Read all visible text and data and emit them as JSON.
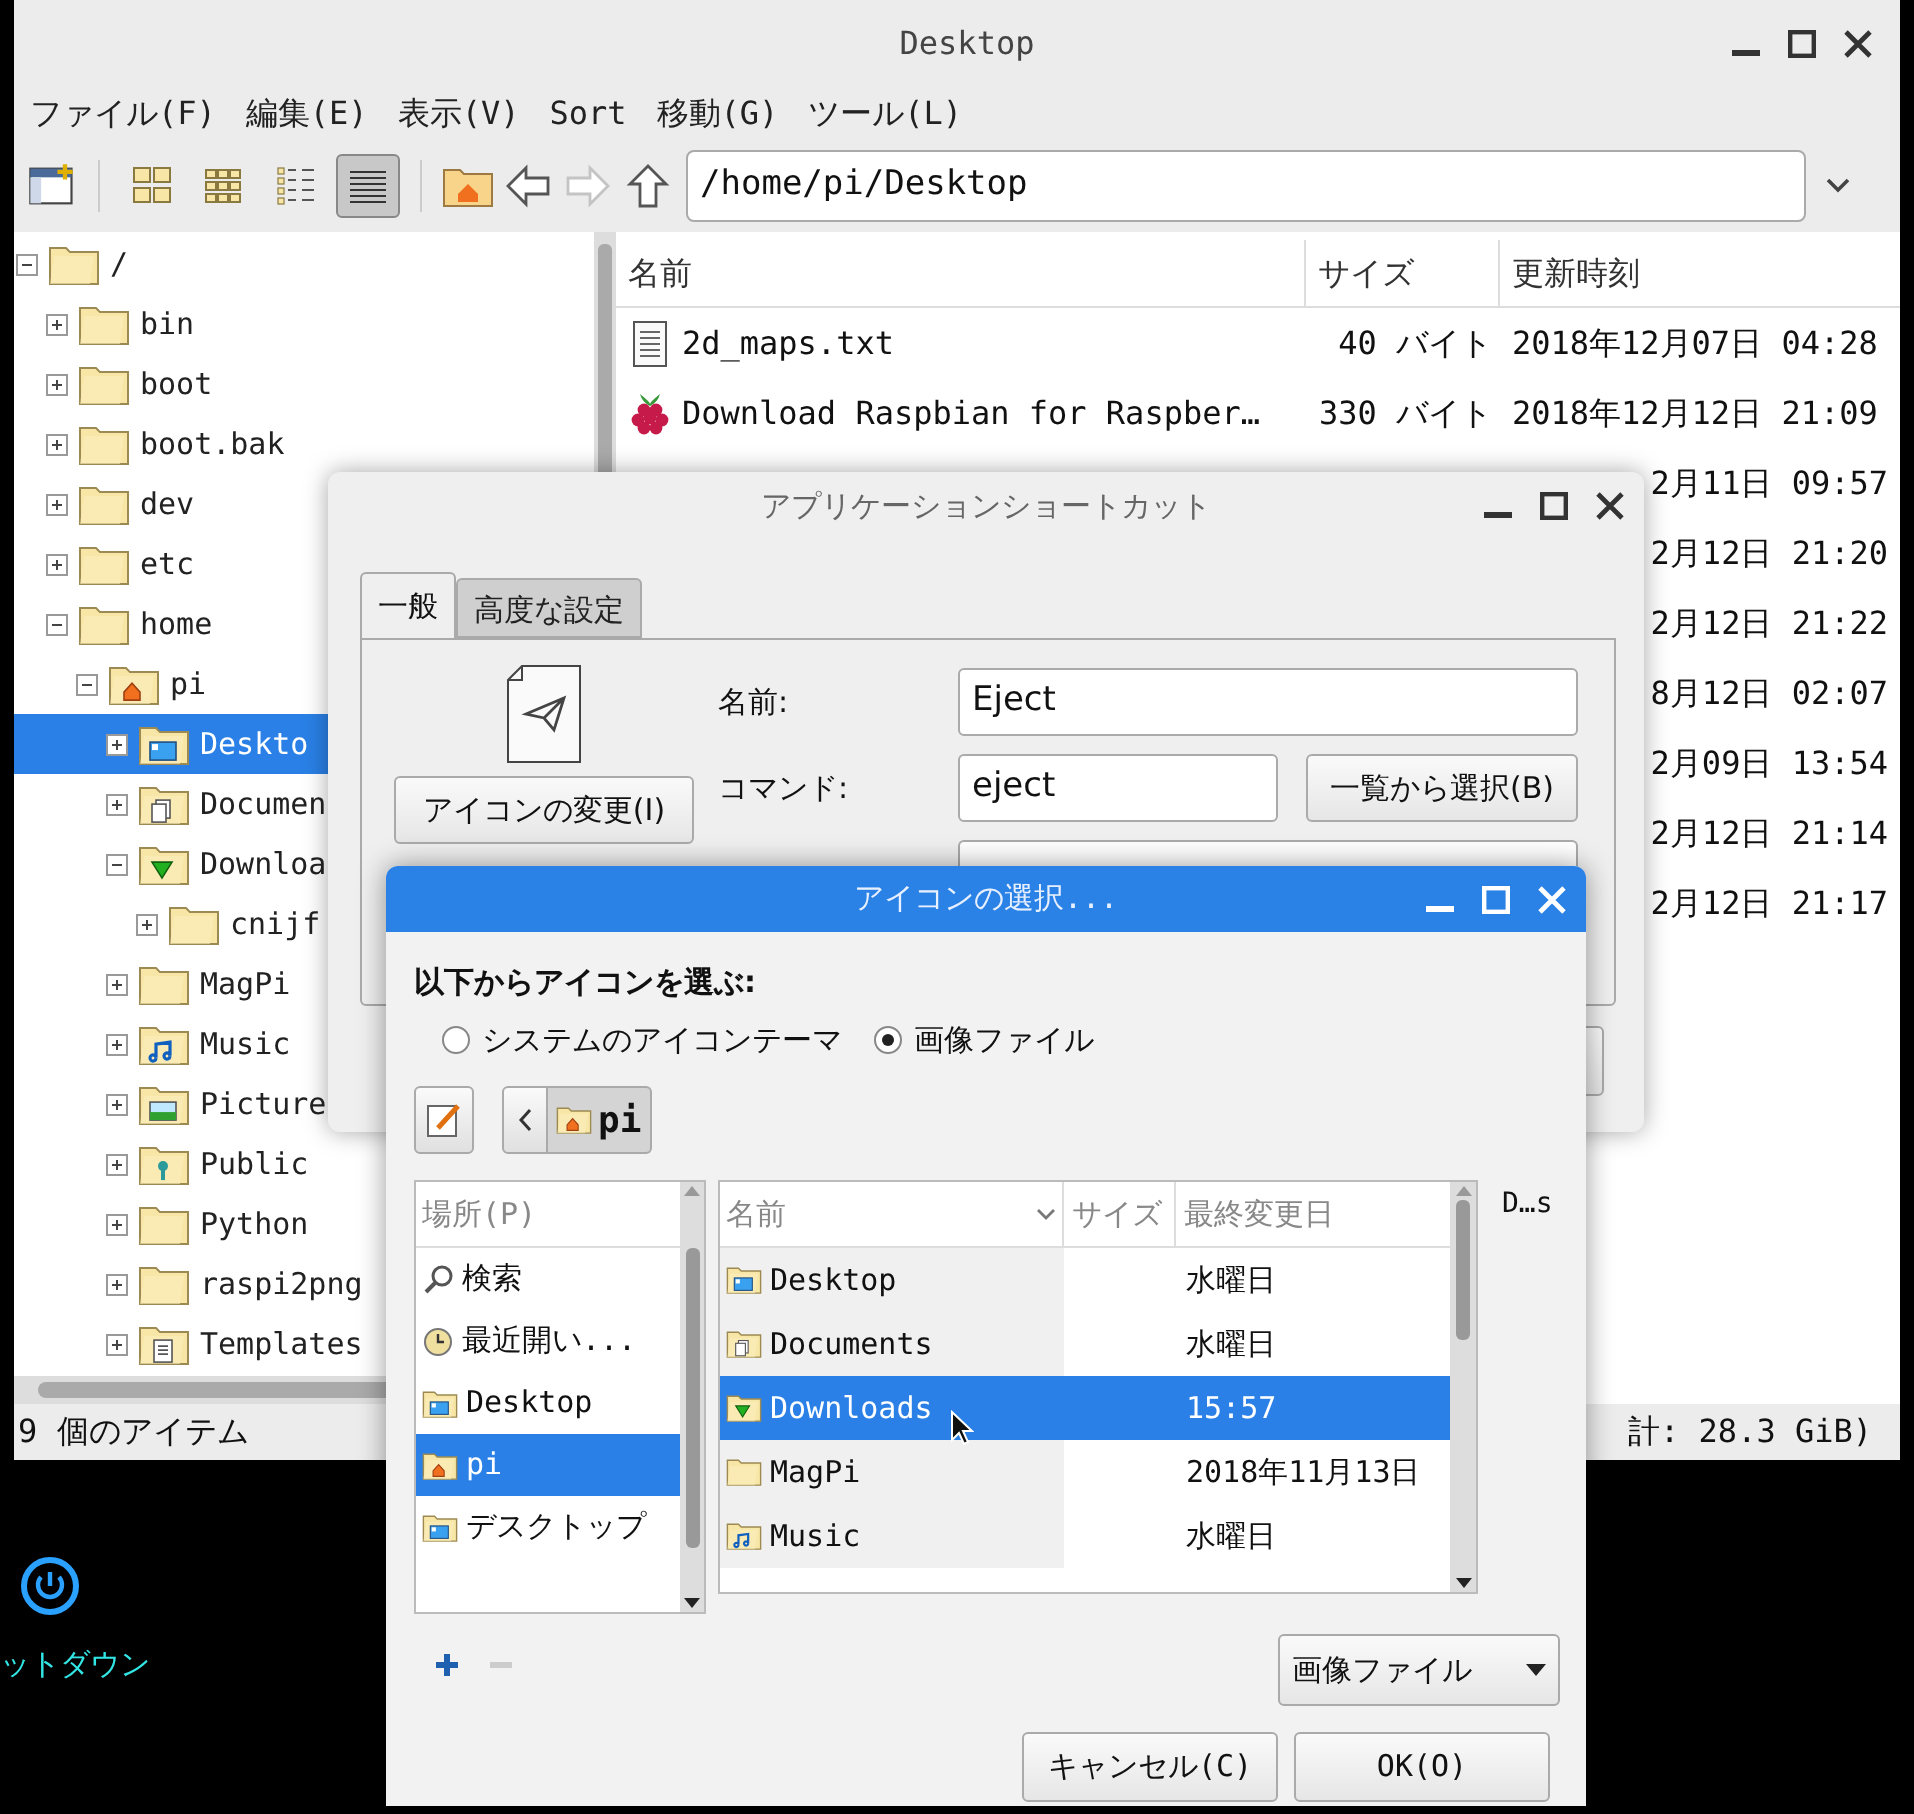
{
  "desktop": {
    "shutdown_label": "ットダウン"
  },
  "file_manager": {
    "title": "Desktop",
    "menu": [
      "ファイル(F)",
      "編集(E)",
      "表示(V)",
      "Sort",
      "移動(G)",
      "ツール(L)"
    ],
    "view_modes": [
      {
        "selected": false
      },
      {
        "selected": false
      },
      {
        "selected": false
      },
      {
        "selected": true
      }
    ],
    "forward_disabled": true,
    "location": "/home/pi/Desktop",
    "tree": [
      {
        "name": "/",
        "kind": "folder",
        "expanded": true,
        "selected": false,
        "children": [
          {
            "name": "bin",
            "kind": "folder",
            "expanded": false,
            "selected": false
          },
          {
            "name": "boot",
            "kind": "folder",
            "expanded": false,
            "selected": false
          },
          {
            "name": "boot.bak",
            "kind": "folder",
            "expanded": false,
            "selected": false
          },
          {
            "name": "dev",
            "kind": "folder",
            "expanded": false,
            "selected": false
          },
          {
            "name": "etc",
            "kind": "folder",
            "expanded": false,
            "selected": false
          },
          {
            "name": "home",
            "kind": "folder",
            "expanded": true,
            "selected": false,
            "children": [
              {
                "name": "pi",
                "kind": "home",
                "expanded": true,
                "selected": false,
                "children": [
                  {
                    "name": "Deskto",
                    "kind": "desktop",
                    "expanded": false,
                    "selected": true
                  },
                  {
                    "name": "Documen",
                    "kind": "documents",
                    "expanded": false,
                    "selected": false
                  },
                  {
                    "name": "Downloa",
                    "kind": "downloads",
                    "expanded": true,
                    "selected": false,
                    "children": [
                      {
                        "name": "cnijf",
                        "kind": "folder",
                        "expanded": false,
                        "selected": false
                      }
                    ]
                  },
                  {
                    "name": "MagPi",
                    "kind": "folder",
                    "expanded": false,
                    "selected": false
                  },
                  {
                    "name": "Music",
                    "kind": "music",
                    "expanded": false,
                    "selected": false
                  },
                  {
                    "name": "Picture",
                    "kind": "pictures",
                    "expanded": false,
                    "selected": false
                  },
                  {
                    "name": "Public",
                    "kind": "public",
                    "expanded": false,
                    "selected": false
                  },
                  {
                    "name": "Python",
                    "kind": "folder",
                    "expanded": false,
                    "selected": false
                  },
                  {
                    "name": "raspi2png",
                    "kind": "folder",
                    "expanded": false,
                    "selected": false
                  },
                  {
                    "name": "Templates",
                    "kind": "templates",
                    "expanded": false,
                    "selected": false
                  }
                ]
              }
            ]
          }
        ]
      }
    ],
    "columns": [
      "名前",
      "サイズ",
      "更新時刻"
    ],
    "files": [
      {
        "kind": "text",
        "name": "2d_maps.txt",
        "size": "40 バイト",
        "modified": "2018年12月07日 04:28"
      },
      {
        "kind": "raspberry",
        "name": "Download Raspbian for Raspber…",
        "size": "330 バイト",
        "modified": "2018年12月12日 21:09"
      },
      {
        "kind": "covered",
        "modified": "2月11日 09:57"
      },
      {
        "kind": "covered",
        "modified": "2月12日 21:20"
      },
      {
        "kind": "covered",
        "modified": "2月12日 21:22"
      },
      {
        "kind": "covered",
        "modified": "8月12日 02:07"
      },
      {
        "kind": "covered",
        "modified": "2月09日 13:54"
      },
      {
        "kind": "covered",
        "modified": "2月12日 21:14"
      },
      {
        "kind": "covered",
        "modified": "2月12日 21:17"
      }
    ],
    "status_left": "9 個のアイテム",
    "status_right": "計: 28.3 GiB)"
  },
  "shortcut_dialog": {
    "title": "アプリケーションショートカット",
    "tabs": [
      {
        "label": "一般",
        "selected": true
      },
      {
        "label": "高度な設定",
        "selected": false
      }
    ],
    "change_icon_button": "アイコンの変更(I)",
    "fields": [
      {
        "label": "名前:",
        "value": "Eject"
      },
      {
        "label": "コマンド:",
        "value": "eject",
        "button": "一覧から選択(B)"
      }
    ]
  },
  "icon_dialog": {
    "title": "アイコンの選択...",
    "prompt": "以下からアイコンを選ぶ:",
    "sources": [
      {
        "label": "システムのアイコンテーマ",
        "selected": false
      },
      {
        "label": "画像ファイル",
        "selected": true
      }
    ],
    "path_button": "pi",
    "places_header": "場所(P)",
    "places": [
      {
        "kind": "search",
        "label": "検索",
        "selected": false
      },
      {
        "kind": "recent",
        "label": "最近開い...",
        "selected": false
      },
      {
        "kind": "desktop",
        "label": "Desktop",
        "selected": false
      },
      {
        "kind": "home",
        "label": "pi",
        "selected": true
      },
      {
        "kind": "desktop",
        "label": "デスクトップ",
        "selected": false
      }
    ],
    "columns": [
      "名前",
      "サイズ",
      "最終変更日"
    ],
    "files": [
      {
        "kind": "desktop",
        "name": "Desktop",
        "modified": "水曜日",
        "selected": false
      },
      {
        "kind": "documents",
        "name": "Documents",
        "modified": "水曜日",
        "selected": false
      },
      {
        "kind": "downloads",
        "name": "Downloads",
        "modified": "15:57",
        "selected": true
      },
      {
        "kind": "folder",
        "name": "MagPi",
        "modified": "2018年11月13日",
        "selected": false
      },
      {
        "kind": "music",
        "name": "Music",
        "modified": "水曜日",
        "selected": false
      }
    ],
    "preview_label": "D…s",
    "filter": "画像ファイル",
    "buttons": [
      "キャンセル(C)",
      "OK(O)"
    ]
  }
}
